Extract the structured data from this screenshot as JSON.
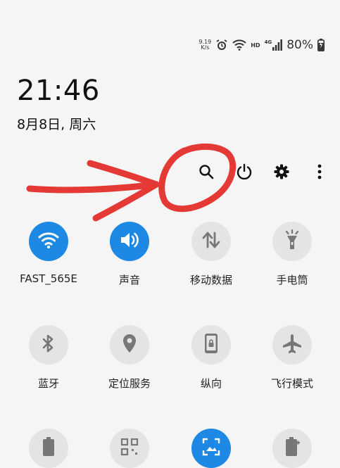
{
  "status_bar": {
    "net_speed_value": "9.19",
    "net_speed_unit": "K/s",
    "hd_label": "HD",
    "network_type": "4G",
    "battery_percent": "80%"
  },
  "clock": {
    "time": "21:46",
    "date": "8月8日, 周六"
  },
  "actions": [
    "search-icon",
    "power-icon",
    "settings-gear-icon",
    "more-vertical-icon"
  ],
  "tiles": [
    {
      "label": "FAST_565E",
      "icon": "wifi-icon",
      "active": true
    },
    {
      "label": "声音",
      "icon": "sound-icon",
      "active": true
    },
    {
      "label": "移动数据",
      "icon": "mobile-data-icon",
      "active": false
    },
    {
      "label": "手电筒",
      "icon": "flashlight-icon",
      "active": false
    },
    {
      "label": "蓝牙",
      "icon": "bluetooth-icon",
      "active": false
    },
    {
      "label": "定位服务",
      "icon": "location-icon",
      "active": false
    },
    {
      "label": "纵向",
      "icon": "portrait-lock-icon",
      "active": false
    },
    {
      "label": "飞行模式",
      "icon": "airplane-icon",
      "active": false
    },
    {
      "icon": "power-saving-icon",
      "active": false
    },
    {
      "icon": "qr-scanner-icon",
      "active": false
    },
    {
      "icon": "screenshot-icon",
      "active": true
    },
    {
      "icon": "battery-plus-icon",
      "active": false
    }
  ],
  "colors": {
    "accent": "#1e88e5",
    "tile_inactive": "#e4e4e4",
    "annotation": "#e53935",
    "background": "#f5f5f5"
  }
}
